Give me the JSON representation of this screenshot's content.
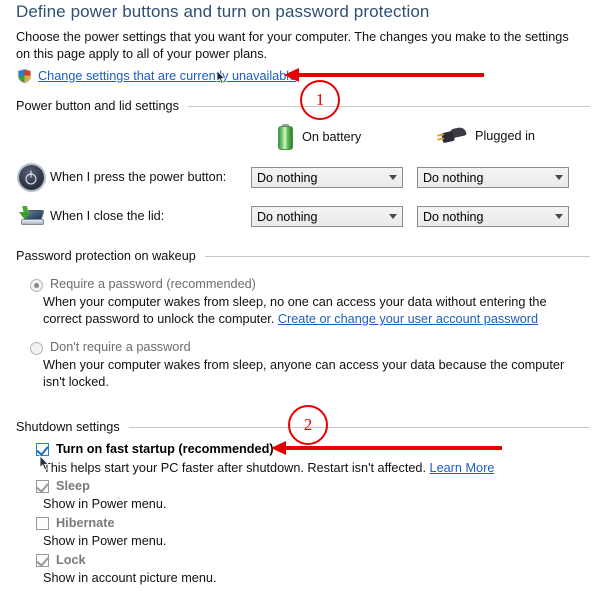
{
  "page": {
    "title": "Define power buttons and turn on password protection",
    "intro": "Choose the power settings that you want for your computer. The changes you make to the settings on this page apply to all of your power plans.",
    "admin_link": "Change settings that are currently unavailable",
    "shield_icon": "uac-shield-icon"
  },
  "power_section": {
    "heading": "Power button and lid settings",
    "columns": [
      {
        "label": "On battery",
        "icon": "battery-icon"
      },
      {
        "label": "Plugged in",
        "icon": "power-plug-icon"
      }
    ],
    "rows": [
      {
        "label": "When I press the power button:",
        "icon": "power-button-icon",
        "on_battery": "Do nothing",
        "plugged_in": "Do nothing"
      },
      {
        "label": "When I close the lid:",
        "icon": "laptop-lid-icon",
        "on_battery": "Do nothing",
        "plugged_in": "Do nothing"
      }
    ]
  },
  "password_section": {
    "heading": "Password protection on wakeup",
    "options": [
      {
        "label": "Require a password (recommended)",
        "selected": true,
        "description_before": "When your computer wakes from sleep, no one can access your data without entering the correct password to unlock the computer. ",
        "link": "Create or change your user account password"
      },
      {
        "label": "Don't require a password",
        "selected": false,
        "description_before": "When your computer wakes from sleep, anyone can access your data because the computer isn't locked.",
        "link": ""
      }
    ]
  },
  "shutdown_section": {
    "heading": "Shutdown settings",
    "items": [
      {
        "label": "Turn on fast startup (recommended)",
        "checked": true,
        "enabled": true,
        "description_before": "This helps start your PC faster after shutdown. Restart isn't affected. ",
        "link": "Learn More"
      },
      {
        "label": "Sleep",
        "checked": true,
        "enabled": false,
        "description_before": "Show in Power menu.",
        "link": ""
      },
      {
        "label": "Hibernate",
        "checked": false,
        "enabled": false,
        "description_before": "Show in Power menu.",
        "link": ""
      },
      {
        "label": "Lock",
        "checked": true,
        "enabled": false,
        "description_before": "Show in account picture menu.",
        "link": ""
      }
    ]
  },
  "annotations": {
    "accent_color": "#e60000",
    "markers": [
      {
        "number": "1",
        "target": "admin-settings-link"
      },
      {
        "number": "2",
        "target": "fast-startup-checkbox"
      }
    ]
  }
}
